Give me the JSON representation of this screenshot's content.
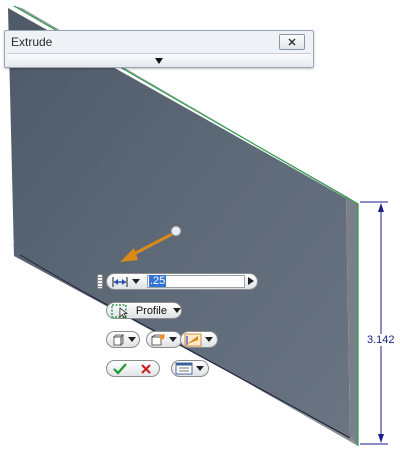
{
  "dialog": {
    "title": "Extrude"
  },
  "minitoolbar": {
    "distance_value": ".25",
    "profile_label": "Profile"
  },
  "dimension": {
    "height_label": "3.142"
  },
  "colors": {
    "plate_face": "#5b6674",
    "plate_side": "#7a7f86",
    "edge_highlight": "#2e9c4a",
    "dimension": "#1e1e8c",
    "direction_arrow": "#d98a16",
    "selection": "#3374d6"
  },
  "icons": [
    "close-icon",
    "expand-arrow-icon",
    "distance-extents-icon",
    "profile-select-icon",
    "solid-output-icon",
    "operation-icon",
    "direction-icon",
    "ok-check-icon",
    "cancel-x-icon",
    "more-options-icon"
  ]
}
